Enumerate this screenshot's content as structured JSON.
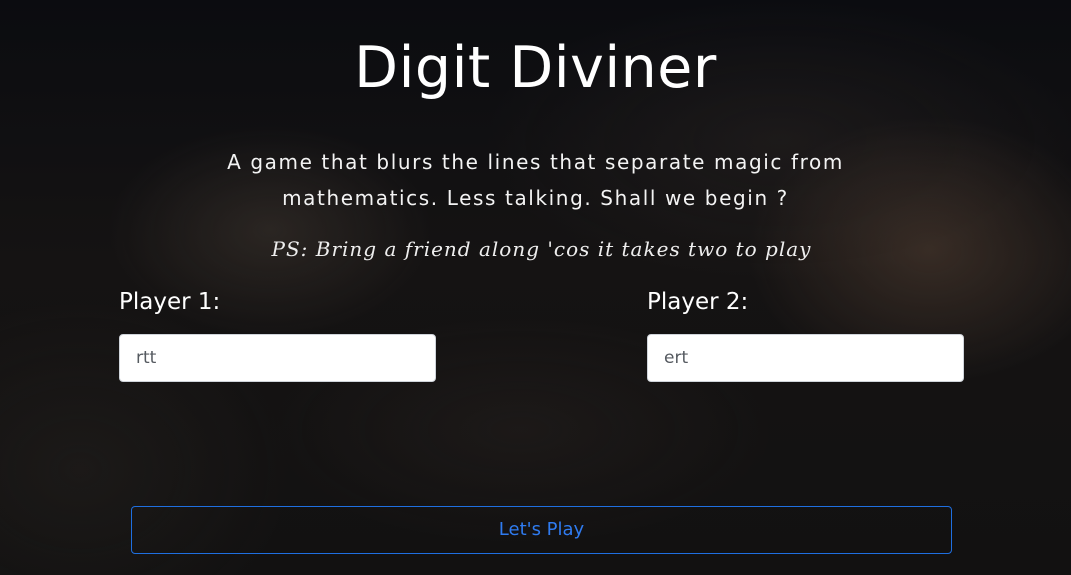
{
  "app": {
    "title": "Digit Diviner",
    "tagline": "A game that blurs the lines that separate magic from mathematics. Less talking. Shall we begin ?",
    "ps": "PS: Bring a friend along 'cos it takes two to play"
  },
  "players": {
    "player1": {
      "label": "Player 1:",
      "value": "rtt"
    },
    "player2": {
      "label": "Player 2:",
      "value": "ert"
    }
  },
  "actions": {
    "play_label": "Let's Play"
  },
  "colors": {
    "accent": "#2f7bf0",
    "text": "#ffffff",
    "background": "#0e0f12"
  }
}
